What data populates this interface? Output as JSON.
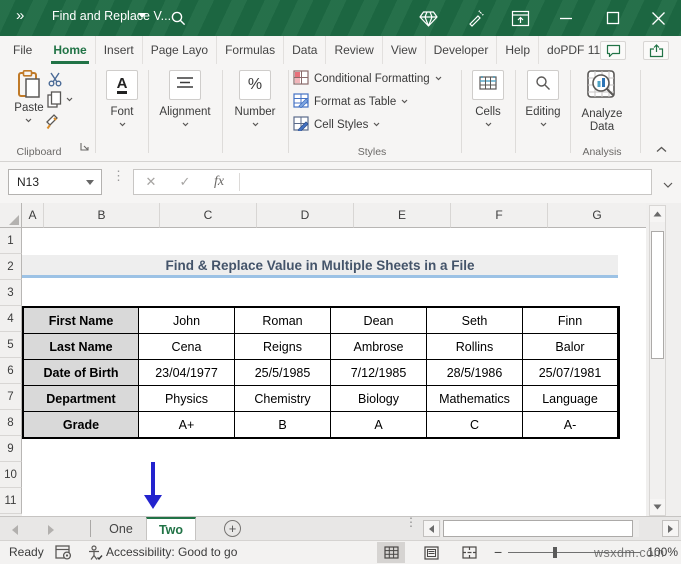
{
  "window": {
    "overflow_glyph": "»",
    "title": "Find and Replace V..."
  },
  "ribbon_tabs": {
    "items": [
      "File",
      "Home",
      "Insert",
      "Page Layo",
      "Formulas",
      "Data",
      "Review",
      "View",
      "Developer",
      "Help",
      "doPDF 11"
    ],
    "active": "Home"
  },
  "ribbon": {
    "clipboard": {
      "paste_label": "Paste",
      "group_label": "Clipboard"
    },
    "font_group": {
      "icon_letter": "A",
      "label": "Font"
    },
    "alignment_group": {
      "label": "Alignment"
    },
    "number_group": {
      "icon_text": "%",
      "label": "Number"
    },
    "styles_group": {
      "items": [
        "Conditional Formatting",
        "Format as Table",
        "Cell Styles"
      ],
      "group_label": "Styles"
    },
    "cells_group": {
      "label": "Cells"
    },
    "editing_group": {
      "label": "Editing"
    },
    "analysis_group": {
      "button_label": "Analyze Data",
      "group_label": "Analysis"
    }
  },
  "formula_bar": {
    "name_box": "N13",
    "fx_label": "fx",
    "formula_value": ""
  },
  "sheet": {
    "columns": [
      "A",
      "B",
      "C",
      "D",
      "E",
      "F",
      "G"
    ],
    "row_numbers": [
      "1",
      "2",
      "3",
      "4",
      "5",
      "6",
      "7",
      "8",
      "9",
      "10",
      "11"
    ],
    "title_banner": "Find & Replace Value in Multiple Sheets in a File",
    "table": {
      "rows": [
        {
          "label": "First Name",
          "values": [
            "John",
            "Roman",
            "Dean",
            "Seth",
            "Finn"
          ]
        },
        {
          "label": "Last Name",
          "values": [
            "Cena",
            "Reigns",
            "Ambrose",
            "Rollins",
            "Balor"
          ]
        },
        {
          "label": "Date of Birth",
          "values": [
            "23/04/1977",
            "25/5/1985",
            "7/12/1985",
            "28/5/1986",
            "25/07/1981"
          ]
        },
        {
          "label": "Department",
          "values": [
            "Physics",
            "Chemistry",
            "Biology",
            "Mathematics",
            "Language"
          ]
        },
        {
          "label": "Grade",
          "values": [
            "A+",
            "B",
            "A",
            "C",
            "A-"
          ]
        }
      ]
    }
  },
  "sheet_tabs": {
    "inactive": "One",
    "active": "Two",
    "add_label": "+"
  },
  "status_bar": {
    "mode": "Ready",
    "accessibility": "Accessibility: Good to go",
    "zoom_level": "100%",
    "watermark": "wsxdm.com"
  },
  "colors": {
    "titlebar_green": "#1E6B44",
    "accent_green": "#217346",
    "banner_text": "#44546A",
    "banner_underline": "#9CC2E5",
    "table_header_bg": "#D9D9D9",
    "arrow_blue": "#2323CE"
  }
}
